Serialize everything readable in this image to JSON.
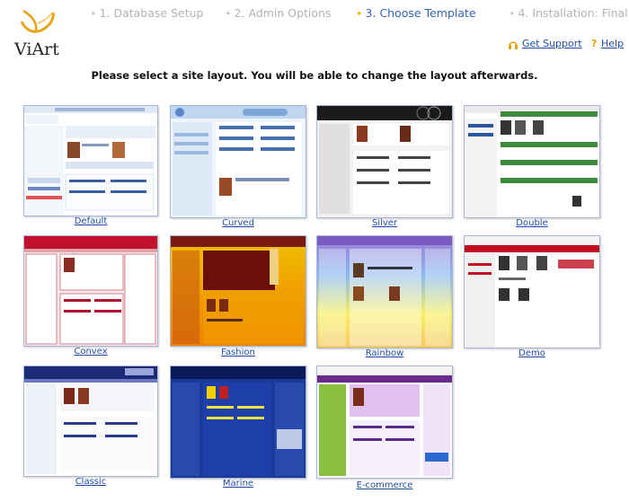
{
  "brand": {
    "name": "ViArt"
  },
  "steps": [
    {
      "label": "1. Database Setup",
      "active": false
    },
    {
      "label": "2. Admin Options",
      "active": false
    },
    {
      "label": "3. Choose Template",
      "active": true
    },
    {
      "label": "4. Installation: Final",
      "active": false
    }
  ],
  "links": {
    "support": "Get Support",
    "help": "Help"
  },
  "instruction": "Please select a site layout. You will be able to change the layout afterwards.",
  "layouts": [
    {
      "name": "Default"
    },
    {
      "name": "Curved"
    },
    {
      "name": "Silver"
    },
    {
      "name": "Double"
    },
    {
      "name": "Convex"
    },
    {
      "name": "Fashion"
    },
    {
      "name": "Rainbow"
    },
    {
      "name": "Demo"
    },
    {
      "name": "Classic"
    },
    {
      "name": "Marine"
    },
    {
      "name": "E-commerce"
    }
  ],
  "colors": {
    "accent": "#3565b8",
    "step_inactive": "#b3b3b3",
    "star_active": "#f0b000",
    "link": "#1f4ea6",
    "logo_gold": "#e8a317"
  }
}
